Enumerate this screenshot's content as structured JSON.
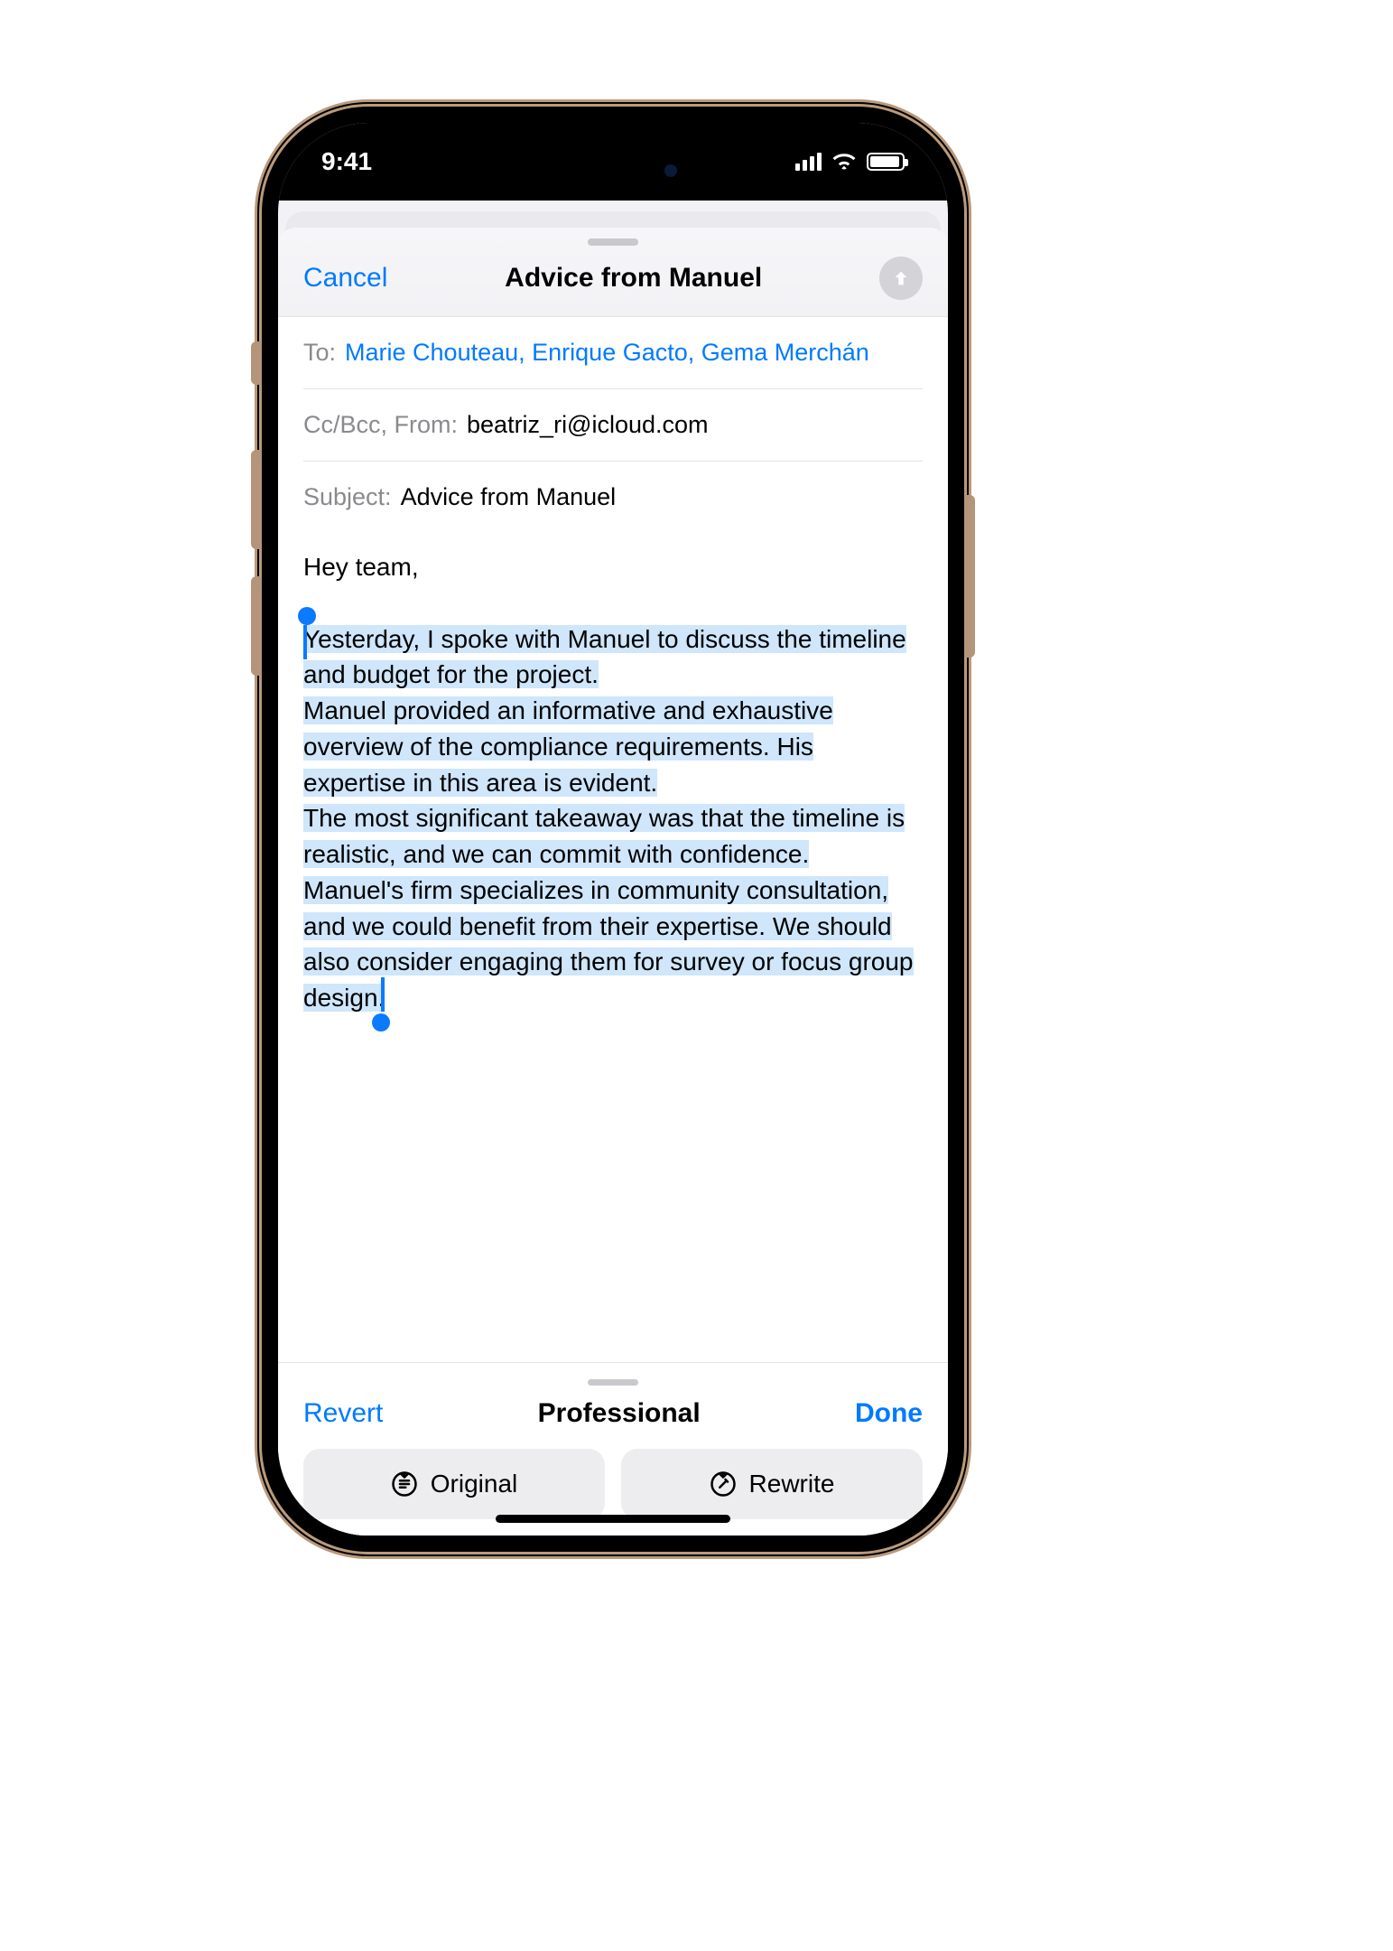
{
  "status": {
    "time": "9:41"
  },
  "header": {
    "cancel": "Cancel",
    "title": "Advice from Manuel"
  },
  "fields": {
    "to_label": "To:",
    "to_value": "Marie Chouteau, Enrique Gacto, Gema Merchán",
    "ccbcc_label": "Cc/Bcc, From:",
    "ccbcc_value": "beatriz_ri@icloud.com",
    "subject_label": "Subject:",
    "subject_value": "Advice from Manuel"
  },
  "body": {
    "greeting": "Hey team,",
    "selected_text": "Yesterday, I spoke with Manuel to discuss the timeline and budget for the project.\nManuel provided an informative and exhaustive overview of the compliance requirements. His expertise in this area is evident.\nThe most significant takeaway was that the timeline is realistic, and we can commit with confidence.\nManuel's firm specializes in community consultation, and we could benefit from their expertise. We should also consider engaging them for survey or focus group design."
  },
  "writing_tools": {
    "revert": "Revert",
    "mode": "Professional",
    "done": "Done",
    "original": "Original",
    "rewrite": "Rewrite"
  }
}
